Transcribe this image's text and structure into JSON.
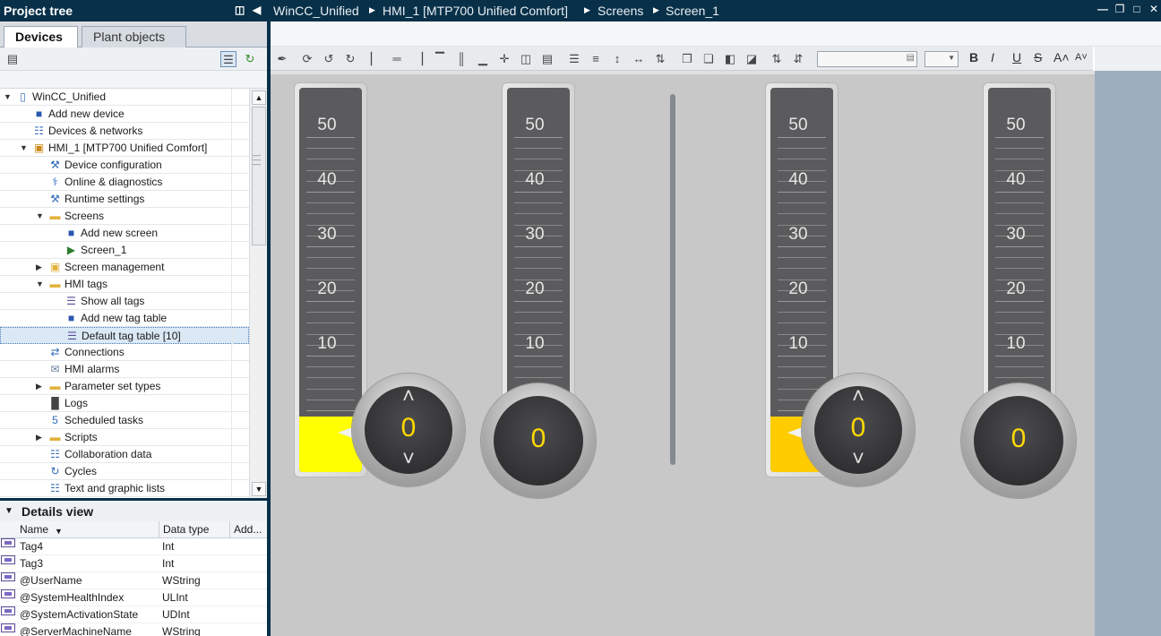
{
  "project_tree": {
    "title": "Project tree",
    "tabs": [
      "Devices",
      "Plant objects"
    ],
    "items": [
      {
        "label": "WinCC_Unified",
        "level": 0,
        "expander": "open",
        "icon": "project-icon"
      },
      {
        "label": "Add new device",
        "level": 1,
        "expander": "none",
        "icon": "add-device-icon"
      },
      {
        "label": "Devices & networks",
        "level": 1,
        "expander": "none",
        "icon": "network-icon"
      },
      {
        "label": "HMI_1 [MTP700 Unified Comfort]",
        "level": 1,
        "expander": "open",
        "icon": "hmi-device-icon"
      },
      {
        "label": "Device configuration",
        "level": 2,
        "expander": "none",
        "icon": "device-config-icon"
      },
      {
        "label": "Online & diagnostics",
        "level": 2,
        "expander": "none",
        "icon": "diagnostics-icon"
      },
      {
        "label": "Runtime settings",
        "level": 2,
        "expander": "none",
        "icon": "runtime-settings-icon"
      },
      {
        "label": "Screens",
        "level": 2,
        "expander": "open",
        "icon": "folder-icon"
      },
      {
        "label": "Add new screen",
        "level": 3,
        "expander": "none",
        "icon": "add-screen-icon"
      },
      {
        "label": "Screen_1",
        "level": 3,
        "expander": "none",
        "icon": "screen-icon"
      },
      {
        "label": "Screen management",
        "level": 2,
        "expander": "closed",
        "icon": "screen-management-icon"
      },
      {
        "label": "HMI tags",
        "level": 2,
        "expander": "open",
        "icon": "tags-folder-icon"
      },
      {
        "label": "Show all tags",
        "level": 3,
        "expander": "none",
        "icon": "show-tags-icon"
      },
      {
        "label": "Add new tag table",
        "level": 3,
        "expander": "none",
        "icon": "add-tag-table-icon"
      },
      {
        "label": "Default tag table [10]",
        "level": 3,
        "expander": "none",
        "icon": "tag-table-icon",
        "selected": true
      },
      {
        "label": "Connections",
        "level": 2,
        "expander": "none",
        "icon": "connections-icon"
      },
      {
        "label": "HMI alarms",
        "level": 2,
        "expander": "none",
        "icon": "alarms-icon"
      },
      {
        "label": "Parameter set types",
        "level": 2,
        "expander": "closed",
        "icon": "folder-icon"
      },
      {
        "label": "Logs",
        "level": 2,
        "expander": "none",
        "icon": "logs-icon"
      },
      {
        "label": "Scheduled tasks",
        "level": 2,
        "expander": "none",
        "icon": "scheduled-tasks-icon"
      },
      {
        "label": "Scripts",
        "level": 2,
        "expander": "closed",
        "icon": "scripts-icon"
      },
      {
        "label": "Collaboration data",
        "level": 2,
        "expander": "none",
        "icon": "collaboration-icon"
      },
      {
        "label": "Cycles",
        "level": 2,
        "expander": "none",
        "icon": "cycles-icon"
      },
      {
        "label": "Text and graphic lists",
        "level": 2,
        "expander": "none",
        "icon": "text-lists-icon"
      }
    ]
  },
  "details_view": {
    "title": "Details view",
    "columns": [
      "Name",
      "Data type",
      "Add..."
    ],
    "rows": [
      {
        "name": "Tag4",
        "type": "Int"
      },
      {
        "name": "Tag3",
        "type": "Int"
      },
      {
        "name": "@UserName",
        "type": "WString"
      },
      {
        "name": "@SystemHealthIndex",
        "type": "ULInt"
      },
      {
        "name": "@SystemActivationState",
        "type": "UDInt"
      },
      {
        "name": "@ServerMachineName",
        "type": "WString"
      }
    ]
  },
  "breadcrumb": [
    "WinCC_Unified",
    "HMI_1 [MTP700 Unified Comfort]",
    "Screens",
    "Screen_1"
  ],
  "format_buttons": [
    "B",
    "I",
    "U",
    "S",
    "A˄",
    "A˅"
  ],
  "thermometers": [
    {
      "scale": [
        "50",
        "40",
        "30",
        "20",
        "10"
      ],
      "value": "0",
      "fill_color": "#ffff00",
      "has_arrows": true
    },
    {
      "scale": [
        "50",
        "40",
        "30",
        "20",
        "10"
      ],
      "value": "0",
      "fill_color": "#ffff00",
      "has_arrows": false
    },
    {
      "scale": [
        "50",
        "40",
        "30",
        "20",
        "10"
      ],
      "value": "0",
      "fill_color": "#ffcc00",
      "has_arrows": true
    },
    {
      "scale": [
        "50",
        "40",
        "30",
        "20",
        "10"
      ],
      "value": "0",
      "fill_color": "#ffcc00",
      "has_arrows": false
    }
  ],
  "colors": {
    "title_bar": "#083049",
    "canvas": "#c8c8c8",
    "value_text": "#ffd900"
  }
}
